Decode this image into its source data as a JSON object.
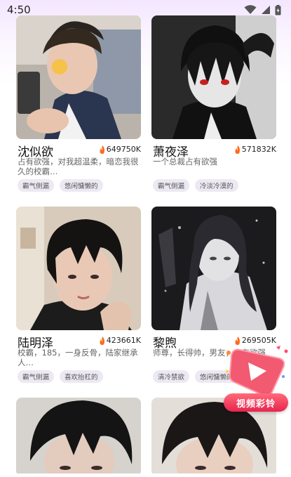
{
  "status_bar": {
    "time": "4:50"
  },
  "characters": [
    {
      "name": "沈似欲",
      "hot": "649750K",
      "desc": "占有欲强，对我超温柔，暗恋我很久的校霸…",
      "tags": [
        "霸气侧漏",
        "悠闲慵懒的"
      ]
    },
    {
      "name": "萧夜泽",
      "hot": "571832K",
      "desc": "一个总裁占有欲强",
      "tags": [
        "霸气侧漏",
        "冷淡冷漠的"
      ]
    },
    {
      "name": "陆明泽",
      "hot": "423661K",
      "desc": "校霸，185，一身反骨，陆家继承人…",
      "tags": [
        "霸气侧漏",
        "喜欢抬杠的"
      ]
    },
    {
      "name": "黎煦",
      "hot": "269505K",
      "desc": "师尊，长得帅，男友，占有欲强",
      "tags": [
        "清冷禁欲",
        "悠闲慵懒的"
      ]
    }
  ],
  "video_widget": {
    "label": "视频彩铃"
  },
  "colors": {
    "accent": "#e8244e",
    "fire": "#ff6a1a",
    "tag_bg": "#ece9f3"
  }
}
